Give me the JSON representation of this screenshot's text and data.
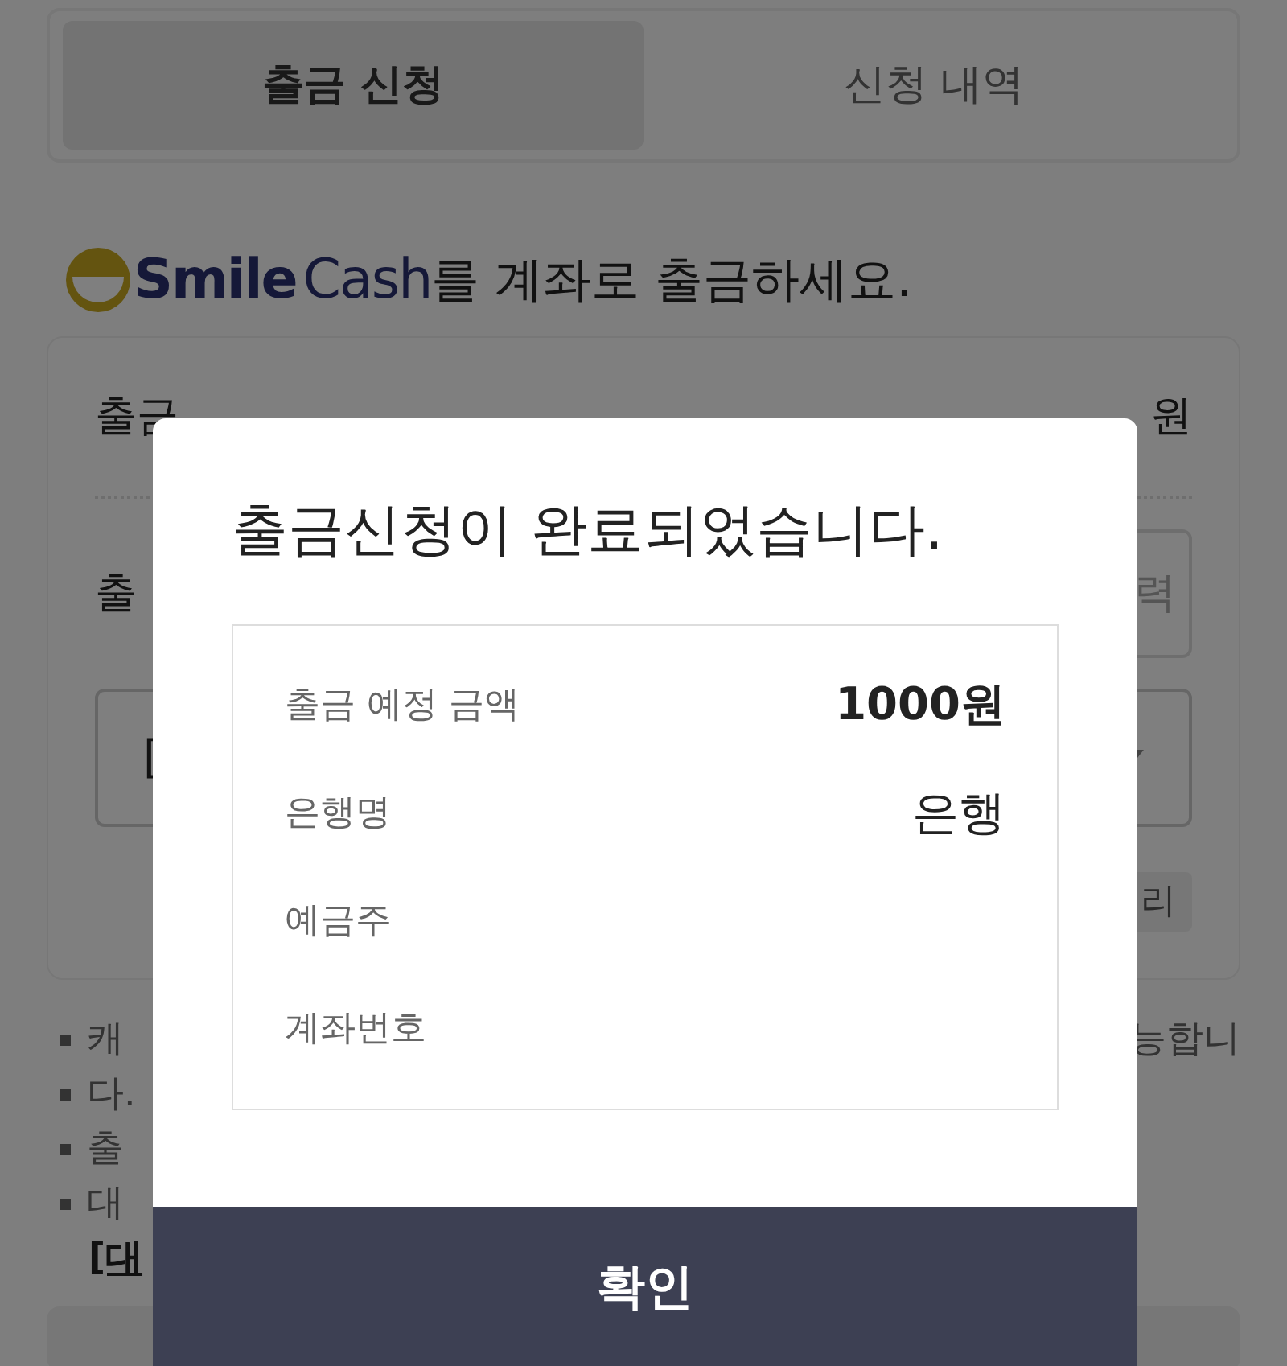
{
  "tabs": [
    {
      "label": "출금 신청",
      "selected": true
    },
    {
      "label": "신청 내역",
      "selected": false
    }
  ],
  "heading": {
    "brand_bold": "Smile",
    "brand_light": "Cash",
    "text": "를 계좌로 출금하세요."
  },
  "form": {
    "available_label": "출금",
    "available_unit": "원",
    "amount_label": "출",
    "amount_placeholder_tail": "력",
    "account_select_text": "[",
    "manage_button": "리"
  },
  "notes": [
    {
      "text": "캐",
      "tail": "능합니"
    },
    {
      "text": "다."
    },
    {
      "text": "출"
    },
    {
      "text": "대"
    }
  ],
  "notes_link": "[대",
  "dialog": {
    "title": "출금신청이 완료되었습니다.",
    "rows": [
      {
        "label": "출금 예정 금액",
        "value": "1000원",
        "kind": "amount"
      },
      {
        "label": "은행명",
        "value": "은행",
        "kind": "text"
      },
      {
        "label": "예금주",
        "kind": "text"
      },
      {
        "label": "계좌번호",
        "kind": "text"
      }
    ],
    "confirm": "확인"
  }
}
